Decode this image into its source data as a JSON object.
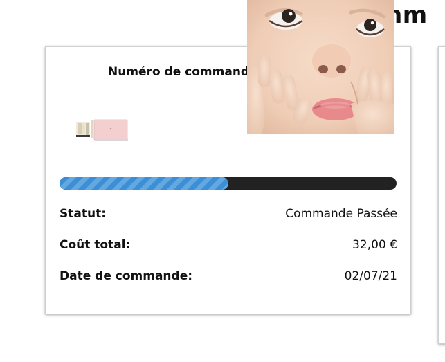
{
  "page": {
    "heading_partial": "omm"
  },
  "order": {
    "number_label": "Numéro de commande",
    "progress_fraction": 0.5,
    "colors": {
      "progress_fill": "#3a8fd6",
      "progress_track": "#222222"
    },
    "rows": [
      {
        "label": "Statut:",
        "value": "Commande Passée"
      },
      {
        "label": "Coût total:",
        "value": "32,00 €"
      },
      {
        "label": "Date de commande:",
        "value": "02/07/21"
      }
    ]
  }
}
